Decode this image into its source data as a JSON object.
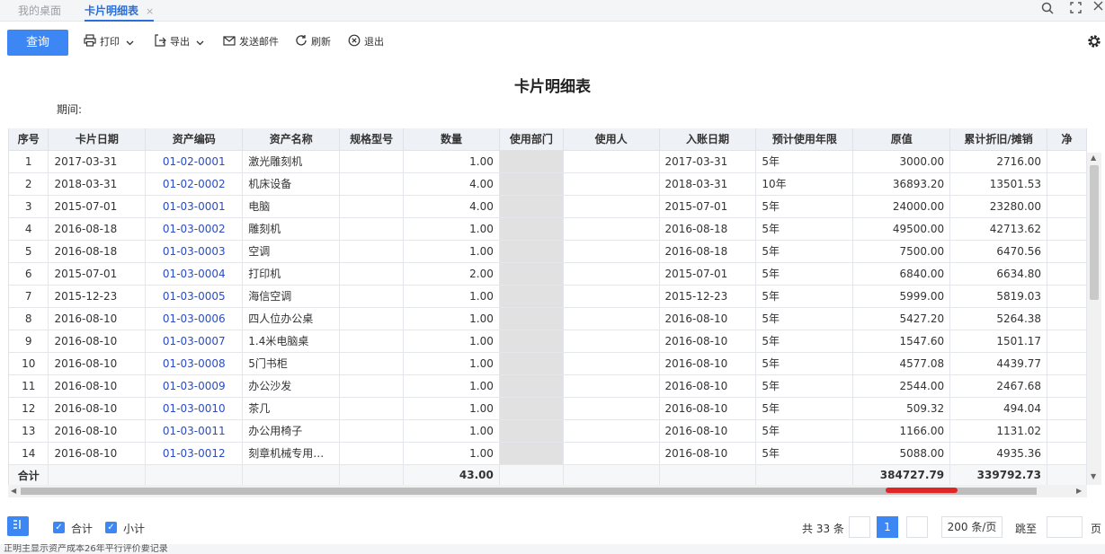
{
  "tabs": [
    {
      "label": "我的桌面",
      "active": false
    },
    {
      "label": "卡片明细表",
      "active": true,
      "close": "×"
    }
  ],
  "toolbar": {
    "query": "查询",
    "print": "打印",
    "export": "导出",
    "send_mail": "发送邮件",
    "refresh": "刷新",
    "exit": "退出"
  },
  "report": {
    "title": "卡片明细表",
    "period_label": "期间:"
  },
  "table": {
    "columns": [
      "序号",
      "卡片日期",
      "资产编码",
      "资产名称",
      "规格型号",
      "数量",
      "使用部门",
      "使用人",
      "入账日期",
      "预计使用年限",
      "原值",
      "累计折旧/摊销",
      "净"
    ],
    "rows": [
      [
        "1",
        "2017-03-31",
        "01-02-0001",
        "激光雕刻机",
        "",
        "1.00",
        "",
        "",
        "2017-03-31",
        "5年",
        "3000.00",
        "2716.00"
      ],
      [
        "2",
        "2018-03-31",
        "01-02-0002",
        "机床设备",
        "",
        "4.00",
        "",
        "",
        "2018-03-31",
        "10年",
        "36893.20",
        "13501.53"
      ],
      [
        "3",
        "2015-07-01",
        "01-03-0001",
        "电脑",
        "",
        "4.00",
        "",
        "",
        "2015-07-01",
        "5年",
        "24000.00",
        "23280.00"
      ],
      [
        "4",
        "2016-08-18",
        "01-03-0002",
        "雕刻机",
        "",
        "1.00",
        "",
        "",
        "2016-08-18",
        "5年",
        "49500.00",
        "42713.62"
      ],
      [
        "5",
        "2016-08-18",
        "01-03-0003",
        "空调",
        "",
        "1.00",
        "",
        "",
        "2016-08-18",
        "5年",
        "7500.00",
        "6470.56"
      ],
      [
        "6",
        "2015-07-01",
        "01-03-0004",
        "打印机",
        "",
        "2.00",
        "",
        "",
        "2015-07-01",
        "5年",
        "6840.00",
        "6634.80"
      ],
      [
        "7",
        "2015-12-23",
        "01-03-0005",
        "海信空调",
        "",
        "1.00",
        "",
        "",
        "2015-12-23",
        "5年",
        "5999.00",
        "5819.03"
      ],
      [
        "8",
        "2016-08-10",
        "01-03-0006",
        "四人位办公桌",
        "",
        "1.00",
        "",
        "",
        "2016-08-10",
        "5年",
        "5427.20",
        "5264.38"
      ],
      [
        "9",
        "2016-08-10",
        "01-03-0007",
        "1.4米电脑桌",
        "",
        "1.00",
        "",
        "",
        "2016-08-10",
        "5年",
        "1547.60",
        "1501.17"
      ],
      [
        "10",
        "2016-08-10",
        "01-03-0008",
        "5门书柜",
        "",
        "1.00",
        "",
        "",
        "2016-08-10",
        "5年",
        "4577.08",
        "4439.77"
      ],
      [
        "11",
        "2016-08-10",
        "01-03-0009",
        "办公沙发",
        "",
        "1.00",
        "",
        "",
        "2016-08-10",
        "5年",
        "2544.00",
        "2467.68"
      ],
      [
        "12",
        "2016-08-10",
        "01-03-0010",
        "茶几",
        "",
        "1.00",
        "",
        "",
        "2016-08-10",
        "5年",
        "509.32",
        "494.04"
      ],
      [
        "13",
        "2016-08-10",
        "01-03-0011",
        "办公用椅子",
        "",
        "1.00",
        "",
        "",
        "2016-08-10",
        "5年",
        "1166.00",
        "1131.02"
      ],
      [
        "14",
        "2016-08-10",
        "01-03-0012",
        "刻章机械专用…",
        "",
        "1.00",
        "",
        "",
        "2016-08-10",
        "5年",
        "5088.00",
        "4935.36"
      ]
    ],
    "total": {
      "label": "合计",
      "quantity": "43.00",
      "original_value": "384727.79",
      "accumulated_depreciation": "339792.73"
    }
  },
  "footer": {
    "total_checkbox": "合计",
    "subtotal_checkbox": "小计",
    "total_count": "共 33 条",
    "current_page": "1",
    "page_size": "200 条/页",
    "goto": "跳至",
    "page_suffix": "页"
  },
  "statusbar": {
    "text": "正明主显示资产成本26年平行评价要记录"
  },
  "colors": {
    "accent": "#3d87f5",
    "code_link": "#2b4cc4",
    "highlight": "#e02525"
  }
}
